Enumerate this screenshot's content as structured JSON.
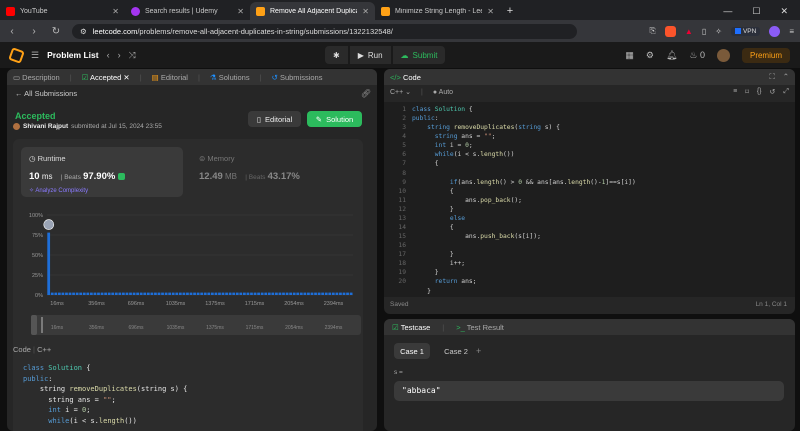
{
  "browser": {
    "tabs": [
      {
        "title": "YouTube",
        "color": "#ff0000"
      },
      {
        "title": "Search results | Udemy",
        "color": "#a435f0"
      },
      {
        "title": "Remove All Adjacent Duplicates",
        "color": "#ffa116"
      },
      {
        "title": "Minimize String Length - LeetCode",
        "color": "#ffa116"
      }
    ],
    "url_domain": "leetcode.com",
    "url_path": "/problems/remove-all-adjacent-duplicates-in-string/submissions/1322132548/",
    "vpn_label": "VPN"
  },
  "header": {
    "title": "Problem List",
    "run_label": "Run",
    "submit_label": "Submit",
    "streak_count": "0",
    "premium_label": "Premium"
  },
  "left_tabs": {
    "description": "Description",
    "accepted": "Accepted",
    "editorial": "Editorial",
    "solutions": "Solutions",
    "submissions": "Submissions"
  },
  "submission": {
    "back_label": "All Submissions",
    "status": "Accepted",
    "user": "Shivani Rajput",
    "submitted_text": "submitted at Jul 15, 2024 23:55",
    "editorial_btn": "Editorial",
    "solution_btn": "Solution",
    "runtime_label": "Runtime",
    "runtime_value": "10",
    "runtime_unit": "ms",
    "beats_label": "Beats",
    "runtime_beats": "97.90%",
    "analyze_label": "Analyze Complexity",
    "memory_label": "Memory",
    "memory_value": "12.49",
    "memory_unit": "MB",
    "memory_beats": "43.17%",
    "code_label": "Code",
    "code_lang": "C++",
    "code_lines": [
      "class Solution {",
      "public:",
      "    string removeDuplicates(string s) {",
      "      string ans = \"\";",
      "      int i = 0;",
      "      while(i < s.length())"
    ]
  },
  "chart_data": {
    "type": "bar",
    "ylabel": "",
    "yticks": [
      "100%",
      "75%",
      "50%",
      "25%",
      "0%"
    ],
    "ylim": [
      0,
      100
    ],
    "xticks": [
      "16ms",
      "356ms",
      "696ms",
      "1035ms",
      "1375ms",
      "1715ms",
      "2054ms",
      "2394ms"
    ],
    "scrubber_ticks": [
      "16ms",
      "356ms",
      "696ms",
      "1035ms",
      "1375ms",
      "1715ms",
      "2054ms",
      "2394ms"
    ],
    "user_bar_index": 0,
    "values": [
      78,
      3,
      3,
      3,
      3,
      3,
      3,
      3,
      3,
      3,
      3,
      3,
      3,
      3,
      3,
      3,
      3,
      3,
      3,
      3,
      3,
      3,
      3,
      3,
      3,
      3,
      3,
      3,
      3,
      3,
      3,
      3,
      3,
      3,
      3,
      3,
      3,
      3,
      3,
      3,
      3,
      3,
      3,
      3,
      3,
      3,
      3,
      3,
      3,
      3,
      3,
      3,
      3,
      3,
      3,
      3,
      3,
      3,
      3,
      3,
      3,
      3,
      3,
      3,
      3,
      3,
      3,
      3,
      3,
      3,
      3,
      3,
      3,
      3,
      3,
      3,
      3,
      3,
      3,
      3,
      3,
      3,
      3,
      3,
      3,
      3
    ],
    "bar_color": "#1e6fd9"
  },
  "editor": {
    "title": "Code",
    "language": "C++",
    "mode": "Auto",
    "saved_label": "Saved",
    "cursor_label": "Ln 1, Col 1",
    "line_numbers": [
      "1",
      "2",
      "3",
      "4",
      "5",
      "6",
      "7",
      "8",
      "9",
      "10",
      "11",
      "12",
      "13",
      "14",
      "15",
      "16",
      "17",
      "18",
      "19",
      "20"
    ]
  },
  "testcase": {
    "tab_label": "Testcase",
    "result_label": "Test Result",
    "case1": "Case 1",
    "case2": "Case 2",
    "add_label": "+",
    "var_label": "s =",
    "value": "\"abbaca\""
  }
}
